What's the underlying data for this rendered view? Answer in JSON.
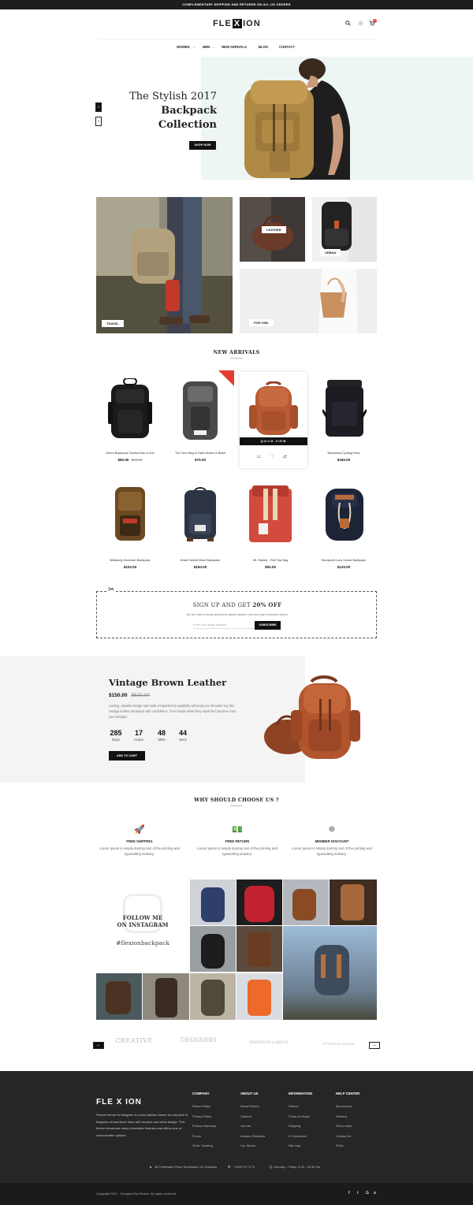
{
  "topbar": "COMPLEMENTARY SHIPPING AND RETURNS ON ALL US ORDERS",
  "logo": {
    "left": "FLE",
    "x": "X",
    "right": "ION"
  },
  "header_icons": [
    "search-icon",
    "gear-icon",
    "cart-icon"
  ],
  "cart_count": "0",
  "nav": {
    "women": "WOMEN",
    "men": "MEN",
    "new_arrivals": "NEW ARRIVALS",
    "blog": "BLOG",
    "contact": "CONTACT"
  },
  "hero": {
    "line1": "The Stylish 2017",
    "line2": "Backpack",
    "line3": "Collection",
    "button": "SHOP NOW",
    "slides": [
      "1",
      "2"
    ]
  },
  "categories": {
    "travel": "TRAVEL",
    "leather": "LEATHER",
    "urban": "URBAN",
    "for_girl": "FOR GIRL"
  },
  "new_arrivals": {
    "title": "NEW ARRIVALS",
    "quick_view": "QUICK VIEW",
    "products": [
      {
        "name": "Men's Backpack Tactical Sac A Dos",
        "price": "$50.00",
        "old_price": "$60.00"
      },
      {
        "name": "The Tech Bag in Dark Molten & Black",
        "price": "$70.00"
      },
      {
        "name": "",
        "price": ""
      },
      {
        "name": "Nanamica Cycling Pack",
        "price": "$150.00"
      },
      {
        "name": "Billabong Mountain Backpack",
        "price": "$232.00"
      },
      {
        "name": "Nnart Sweed Blunt Backpack",
        "price": "$150.00"
      },
      {
        "name": "Mt. Rainier - Roll Top Bag",
        "price": "$50.00"
      },
      {
        "name": "Sandpoint Lars Gonas Backpack",
        "price": "$120.00"
      }
    ],
    "sale_badge": "SALE"
  },
  "signup": {
    "title_a": "SIGN UP AND GET ",
    "title_b": "20% OFF",
    "text": "Be the first to know about the latest fashion new and get exclusive offers",
    "placeholder": "Enter your email address",
    "button": "SUBSCRIBE"
  },
  "deal": {
    "title": "Vintage Brown Leather",
    "price": "$150.00",
    "old_price": "$630.00",
    "desc": "Lasting, durable design and multi compartment capability will keep you shoulder-ing this vintage leather backpack with confidence. Turn heads whilst they mark find (achieve from your designs.",
    "countdown": [
      {
        "n": "285",
        "l": "Days"
      },
      {
        "n": "17",
        "l": "Hours"
      },
      {
        "n": "48",
        "l": "Mins"
      },
      {
        "n": "44",
        "l": "Secs"
      }
    ],
    "button": "ADD TO CART"
  },
  "why": {
    "title": "WHY SHOULD CHOOSE US ?",
    "items": [
      {
        "icon": "rocket-icon",
        "title": "FREE SHIPPING",
        "desc": "Lorem Ipsum is simply dummy text of the printing and typesetting industry."
      },
      {
        "icon": "money-icon",
        "title": "FREE RETURN",
        "desc": "Lorem Ipsum is simply dummy text of the printing and typesetting industry."
      },
      {
        "icon": "discount-icon",
        "title": "MEMBER DISCOUNT",
        "desc": "Lorem Ipsum is simply dummy text of the printing and typesetting industry."
      }
    ]
  },
  "instagram": {
    "line1": "FOLLOW ME",
    "line2": "ON INSTAGRAM",
    "tag": "#flexionbackpack"
  },
  "partners": [
    "CREATIVE",
    "DESIGNERS",
    "PREMIUM LABELS",
    "Premium Goods"
  ],
  "footer": {
    "logo": "FLE X ION",
    "about": "Flexion theme for Magento is a nice fashion theme for any kind of Magento eCommerce store with modern and clean design. This theme introduces many innovative features and offers tons of customizable options.",
    "cols": [
      {
        "title": "COMPANY",
        "items": [
          "Return Policy",
          "Privacy Policy",
          "Product Warranty",
          "Forum",
          "Order Tracking"
        ]
      },
      {
        "title": "ABOUT US",
        "items": [
          "About Flexion",
          "Careers",
          "Journal",
          "Investor Relations",
          "Our Stores"
        ]
      },
      {
        "title": "INFORMATION",
        "items": [
          "Refund",
          "Policy for Buyer",
          "Shipping",
          "E-Commerce",
          "Site map"
        ]
      },
      {
        "title": "HELP CENTER",
        "items": [
          "My Account",
          "Delivery",
          "Find a store",
          "Contact Us",
          "FAQs"
        ]
      }
    ],
    "address": "28 Freshwater Place Southbank VIC Australia",
    "phone": "+1300 73 73 73",
    "hours": "Monday - Friday: 8.00 - 18.30 Hrs",
    "copyright": "Copyright 2017 - Designed by Flexion. All rights reserved",
    "social": [
      "f",
      "t",
      "G",
      "o"
    ]
  }
}
